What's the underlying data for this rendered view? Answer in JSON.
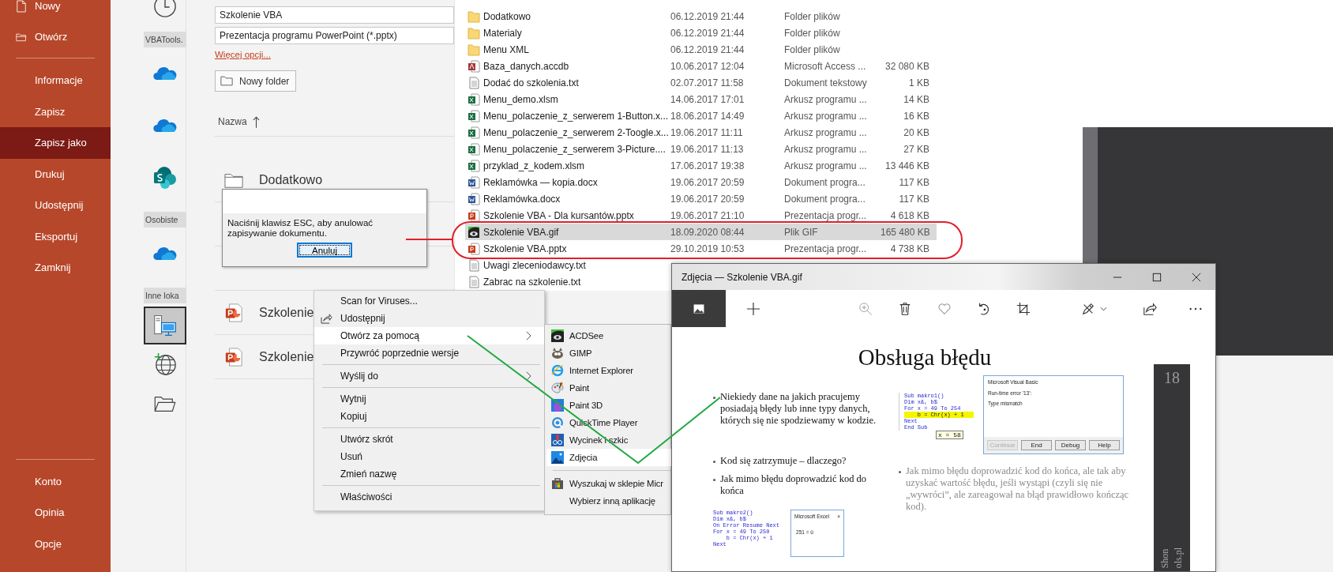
{
  "sidebar": {
    "top_items": [
      {
        "label": "Nowy",
        "kind": "new"
      },
      {
        "label": "Otwórz",
        "kind": "open"
      }
    ],
    "items": [
      {
        "label": "Informacje",
        "selected": false
      },
      {
        "label": "Zapisz",
        "selected": false
      },
      {
        "label": "Zapisz jako",
        "selected": true
      },
      {
        "label": "Drukuj",
        "selected": false
      },
      {
        "label": "Udostępnij",
        "selected": false
      },
      {
        "label": "Eksportuj",
        "selected": false
      },
      {
        "label": "Zamknij",
        "selected": false
      }
    ],
    "bottom_items": [
      {
        "label": "Konto"
      },
      {
        "label": "Opinia"
      },
      {
        "label": "Opcje"
      }
    ]
  },
  "locations": [
    {
      "kind": "recent",
      "selected": false
    },
    {
      "kind": "heading",
      "label": "VBATools."
    },
    {
      "kind": "onedrive",
      "selected": false
    },
    {
      "kind": "onedrive",
      "selected": false
    },
    {
      "kind": "sharepoint",
      "selected": false
    },
    {
      "kind": "heading",
      "label": "Osobiste"
    },
    {
      "kind": "onedrive",
      "selected": false
    },
    {
      "kind": "heading",
      "label": "Inne loka"
    },
    {
      "kind": "computer",
      "selected": true
    },
    {
      "kind": "web",
      "selected": false
    },
    {
      "kind": "browse",
      "selected": false
    }
  ],
  "save": {
    "file_name": "Szkolenie VBA",
    "file_type": "Prezentacja programu PowerPoint (*.pptx)",
    "more_options": "Więcej opcji...",
    "new_folder": "Nowy folder",
    "sort_column": "Nazwa",
    "files": [
      {
        "kind": "folder",
        "name": "Dodatkowo"
      },
      {
        "kind": "covered"
      },
      {
        "kind": "covered"
      },
      {
        "kind": "ppt",
        "name": "Szkolenie"
      },
      {
        "kind": "ppt",
        "name": "Szkolenie"
      }
    ]
  },
  "dialog": {
    "message": "Naciśnij klawisz ESC, aby anulować zapisywanie dokumentu.",
    "button": "Anuluj"
  },
  "explorer": {
    "rows": [
      {
        "kind": "folder",
        "name": "Dodatkowo",
        "date": "06.12.2019 21:44",
        "type": "Folder plików",
        "selected": false
      },
      {
        "kind": "folder",
        "name": "Materialy",
        "date": "06.12.2019 21:44",
        "type": "Folder plików",
        "selected": false
      },
      {
        "kind": "folder",
        "name": "Menu XML",
        "date": "06.12.2019 21:44",
        "type": "Folder plików",
        "selected": false
      },
      {
        "kind": "access",
        "name": "Baza_danych.accdb",
        "date": "10.06.2017 12:04",
        "type": "Microsoft Access ...",
        "size": "32 080 KB",
        "selected": false
      },
      {
        "kind": "text",
        "name": "Dodać do szkolenia.txt",
        "date": "02.07.2017 11:58",
        "type": "Dokument tekstowy",
        "size": "1 KB",
        "selected": false
      },
      {
        "kind": "excel",
        "name": "Menu_demo.xlsm",
        "date": "14.06.2017 17:01",
        "type": "Arkusz programu ...",
        "size": "14 KB",
        "selected": false
      },
      {
        "kind": "excel",
        "name": "Menu_polaczenie_z_serwerem 1-Button.x...",
        "date": "18.06.2017 14:49",
        "type": "Arkusz programu ...",
        "size": "16 KB",
        "selected": false
      },
      {
        "kind": "excel",
        "name": "Menu_polaczenie_z_serwerem 2-Toogle.x...",
        "date": "19.06.2017 11:11",
        "type": "Arkusz programu ...",
        "size": "20 KB",
        "selected": false
      },
      {
        "kind": "excel",
        "name": "Menu_polaczenie_z_serwerem 3-Picture....",
        "date": "19.06.2017 11:13",
        "type": "Arkusz programu ...",
        "size": "27 KB",
        "selected": false
      },
      {
        "kind": "excel",
        "name": "przyklad_z_kodem.xlsm",
        "date": "17.06.2017 19:38",
        "type": "Arkusz programu ...",
        "size": "13 446 KB",
        "selected": false
      },
      {
        "kind": "word",
        "name": "Reklamówka — kopia.docx",
        "date": "19.06.2017 20:59",
        "type": "Dokument progra...",
        "size": "117 KB",
        "selected": false
      },
      {
        "kind": "word",
        "name": "Reklamówka.docx",
        "date": "19.06.2017 20:59",
        "type": "Dokument progra...",
        "size": "117 KB",
        "selected": false
      },
      {
        "kind": "ppt",
        "name": "Szkolenie VBA - Dla kursantów.pptx",
        "date": "19.06.2017 21:10",
        "type": "Prezentacja progr...",
        "size": "4 618 KB",
        "selected": false
      },
      {
        "kind": "gif",
        "name": "Szkolenie VBA.gif",
        "date": "18.09.2020 08:44",
        "type": "Plik GIF",
        "size": "165 480 KB",
        "selected": true
      },
      {
        "kind": "ppt",
        "name": "Szkolenie VBA.pptx",
        "date": "29.10.2019 10:53",
        "type": "Prezentacja progr...",
        "size": "4 738 KB",
        "selected": false
      },
      {
        "kind": "text",
        "name": "Uwagi zleceniodawcy.txt",
        "selected": false
      },
      {
        "kind": "text",
        "name": "Zabrac na szkolenie.txt",
        "selected": false
      }
    ]
  },
  "context_menu": {
    "groups": [
      [
        {
          "label": "Scan for Viruses...",
          "submenu": false,
          "selected": false
        },
        {
          "label": "Udostępnij",
          "kind": "share",
          "submenu": false,
          "selected": false
        },
        {
          "label": "Otwórz za pomocą",
          "submenu": true,
          "selected": true
        },
        {
          "label": "Przywróć poprzednie wersje",
          "submenu": false,
          "selected": false
        }
      ],
      [
        {
          "label": "Wyślij do",
          "submenu": true,
          "selected": false
        }
      ],
      [
        {
          "label": "Wytnij",
          "submenu": false,
          "selected": false
        },
        {
          "label": "Kopiuj",
          "submenu": false,
          "selected": false
        }
      ],
      [
        {
          "label": "Utwórz skrót",
          "submenu": false,
          "selected": false
        },
        {
          "label": "Usuń",
          "submenu": false,
          "selected": false
        },
        {
          "label": "Zmień nazwę",
          "submenu": false,
          "selected": false
        }
      ],
      [
        {
          "label": "Właściwości",
          "submenu": false,
          "selected": false
        }
      ]
    ]
  },
  "open_with_menu": {
    "groups": [
      [
        {
          "kind": "acdsee",
          "label": "ACDSee",
          "selected": false
        },
        {
          "kind": "gimp",
          "label": "GIMP",
          "selected": false
        },
        {
          "kind": "ie",
          "label": "Internet Explorer",
          "selected": false
        },
        {
          "kind": "paint",
          "label": "Paint",
          "selected": false
        },
        {
          "kind": "paint3d",
          "label": "Paint 3D",
          "selected": false
        },
        {
          "kind": "quicktime",
          "label": "QuickTime Player",
          "selected": false
        },
        {
          "kind": "snip",
          "label": "Wycinek i szkic",
          "selected": false
        },
        {
          "kind": "photos",
          "label": "Zdjęcia",
          "selected": true
        }
      ],
      [
        {
          "kind": "store",
          "label": "Wyszukaj w sklepie Micr",
          "selected": false
        },
        {
          "kind": "none",
          "label": "Wybierz inną aplikację",
          "selected": false
        }
      ]
    ]
  },
  "photos": {
    "title": "Zdjęcia — Szkolenie VBA.gif",
    "slide": {
      "title": "Obsługa błędu",
      "page": "18",
      "side_text": [
        "Shon",
        "ols.pl"
      ],
      "bullets": [
        {
          "text": "Niekiedy dane na jakich pracujemy posiadają błędy lub inne typy danych, których się nie spodziewamy w kodzie.",
          "dimmed": false
        },
        {
          "text": "Kod się zatrzymuje – dlaczego?",
          "dimmed": false
        },
        {
          "text": "Jak mimo błędu doprowadzić kod do końca",
          "dimmed": false
        }
      ],
      "code_1": [
        {
          "text": "Sub makro1()",
          "highlight": false
        },
        {
          "text": "Dim x&, b$",
          "highlight": false
        },
        {
          "text": "For x = 49 To 254",
          "highlight": false
        },
        {
          "text": "    b = Chr(x) + 1",
          "highlight": true
        },
        {
          "text": "Next",
          "highlight": false
        },
        {
          "text": "End Sub",
          "highlight": false
        }
      ],
      "tooltip": "x = 58",
      "vb_dialog": {
        "title": "Microsoft Visual Basic",
        "lines": [
          "Run-time error '13':",
          "Type mismatch"
        ],
        "buttons": [
          {
            "label": "Continue",
            "disabled": true
          },
          {
            "label": "End",
            "disabled": false
          },
          {
            "label": "Debug",
            "disabled": false
          },
          {
            "label": "Help",
            "disabled": false
          }
        ]
      },
      "note": {
        "text": "Jak mimo błędu doprowadzić kod do końca, ale tak aby uzyskać wartość błędu, jeśli wystąpi (czyli się nie „wywróci”, ale zareagował na błąd prawidłowo kończąc kod).",
        "dimmed": true
      },
      "code_2": [
        {
          "text": "Sub makro2()",
          "highlight": false
        },
        {
          "text": "Dim x&, b$",
          "highlight": false
        },
        {
          "text": "On Error Resume Next",
          "highlight": false
        },
        {
          "text": "For x = 49 To 250",
          "highlight": false
        },
        {
          "text": "    b = Chr(x) + 1",
          "highlight": false
        },
        {
          "text": "Next",
          "highlight": false
        }
      ],
      "excel_box": {
        "title": "Microsoft Excel",
        "close": "×",
        "text": "251 = û"
      }
    }
  }
}
